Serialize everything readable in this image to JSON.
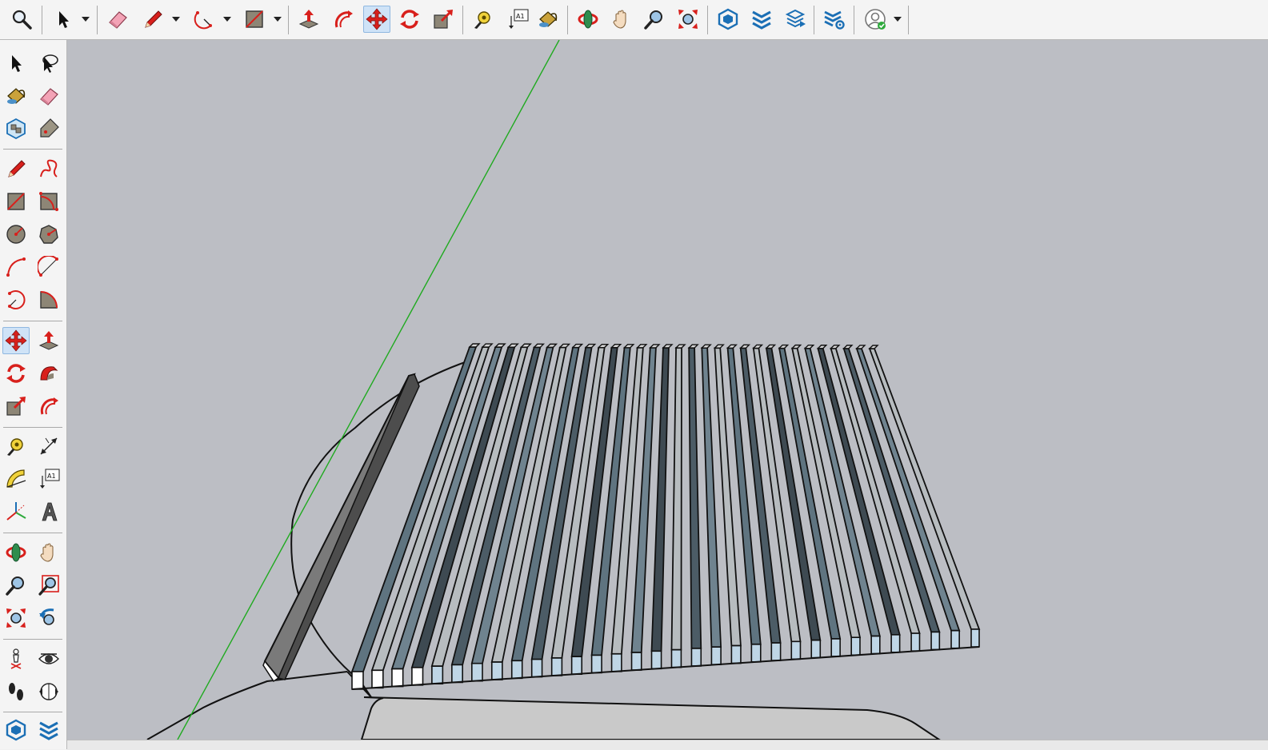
{
  "app": {
    "icons": {
      "magnifier": "magnifier-icon",
      "select": "select-arrow-icon",
      "eraser": "eraser-icon",
      "pencil": "pencil-line-icon",
      "arc": "arc-icon",
      "rectangle": "rectangle-icon",
      "push_pull": "push-pull-icon",
      "offset": "offset-icon",
      "move": "move-icon",
      "rotate": "rotate-icon",
      "scale": "scale-icon",
      "tape": "tape-measure-icon",
      "text": "text-label-icon",
      "paint": "paint-bucket-icon",
      "orbit": "orbit-icon",
      "pan": "pan-hand-icon",
      "zoom": "zoom-icon",
      "zoom_extents": "zoom-extents-icon",
      "warehouse": "3d-warehouse-icon",
      "extension_warehouse": "extension-warehouse-icon",
      "layout": "send-to-layout-icon",
      "extension_manager": "extension-manager-icon",
      "account": "account-icon"
    },
    "toolbar_labels": {
      "text_tool_glyph": "A1",
      "protractor_glyph": "A1"
    },
    "colors": {
      "viewport_bg": "#bcbec4",
      "toolbar_bg": "#f4f4f4",
      "active_tool_bg": "#cfe3f7",
      "accent_red": "#d8201c",
      "axis_green": "#1faa1f",
      "slat_dark": "#5f7480",
      "slat_light": "#b7bcbf",
      "slat_face": "#bfd6e6"
    },
    "active_tool": "move"
  }
}
